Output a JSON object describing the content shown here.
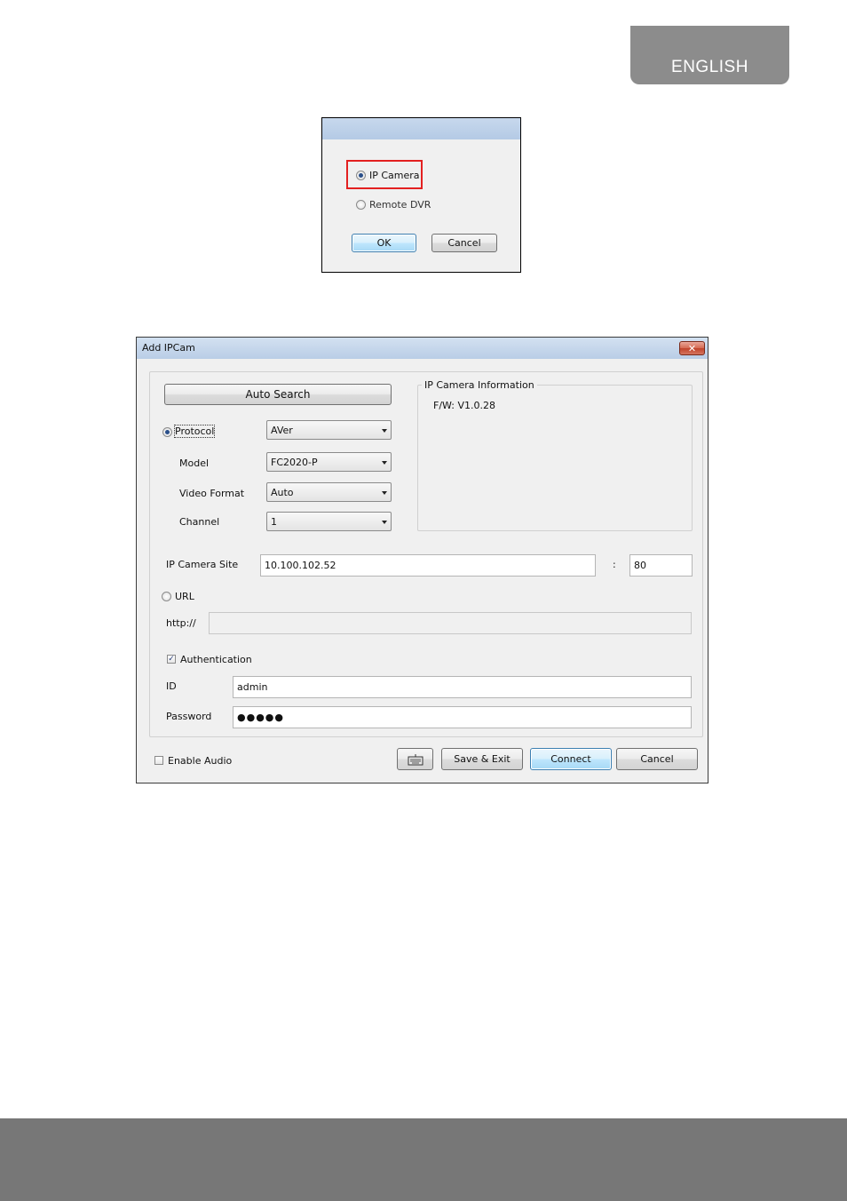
{
  "header": {
    "language": "ENGLISH"
  },
  "type_dialog": {
    "options": {
      "ip_camera": "IP Camera",
      "remote_dvr": "Remote DVR"
    },
    "selected": "ip_camera",
    "ok_label": "OK",
    "cancel_label": "Cancel"
  },
  "add_ipcam_dialog": {
    "title": "Add IPCam",
    "close_label": "✕",
    "auto_search_label": "Auto Search",
    "protocol": {
      "label": "Protocol",
      "value": "AVer"
    },
    "model": {
      "label": "Model",
      "value": "FC2020-P"
    },
    "video_format": {
      "label": "Video Format",
      "value": "Auto"
    },
    "channel": {
      "label": "Channel",
      "value": "1"
    },
    "info_panel": {
      "title": "IP Camera Information",
      "firmware": "F/W: V1.0.28"
    },
    "site": {
      "label": "IP Camera Site",
      "value": "10.100.102.52",
      "separator": ":",
      "port": "80"
    },
    "url": {
      "label": "URL",
      "prefix": "http://",
      "value": ""
    },
    "authentication": {
      "label": "Authentication",
      "checked": true,
      "check_mark": "✓"
    },
    "id": {
      "label": "ID",
      "value": "admin"
    },
    "password": {
      "label": "Password",
      "value": "●●●●●"
    },
    "enable_audio": {
      "label": "Enable Audio",
      "checked": false
    },
    "buttons": {
      "save_exit": "Save & Exit",
      "connect": "Connect",
      "cancel": "Cancel"
    }
  }
}
